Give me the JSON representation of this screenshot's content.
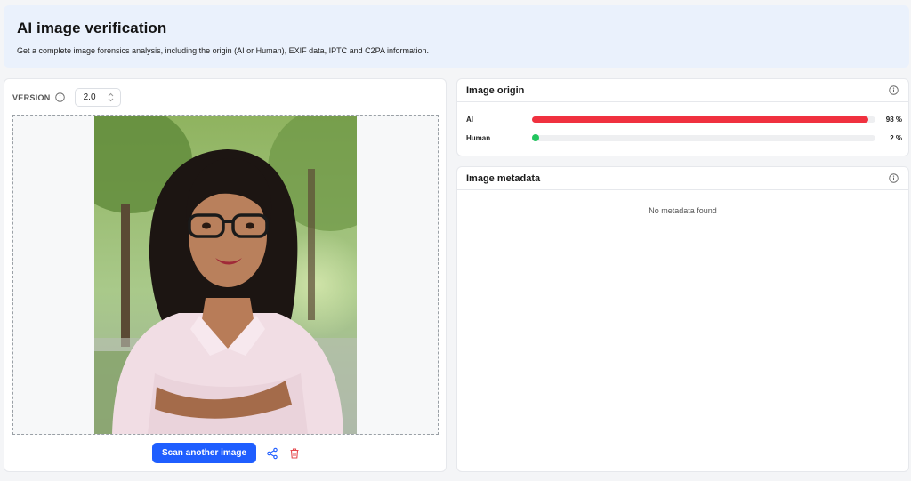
{
  "header": {
    "title": "AI image verification",
    "subtitle": "Get a complete image forensics analysis, including the origin (AI or Human), EXIF data, IPTC and C2PA information."
  },
  "version": {
    "label": "VERSION",
    "value": "2.0"
  },
  "actions": {
    "scan_label": "Scan another image",
    "share_icon": "share-icon",
    "delete_icon": "trash-icon"
  },
  "origin": {
    "title": "Image origin",
    "rows": [
      {
        "label": "AI",
        "value": 98,
        "pct_label": "98 %",
        "color": "#f0313f"
      },
      {
        "label": "Human",
        "value": 2,
        "pct_label": "2 %",
        "color": "#22c55e"
      }
    ]
  },
  "metadata": {
    "title": "Image metadata",
    "empty_text": "No metadata found"
  },
  "colors": {
    "accent": "#1f5eff",
    "delete": "#e5484d",
    "header_bg": "#eaf1fc"
  }
}
